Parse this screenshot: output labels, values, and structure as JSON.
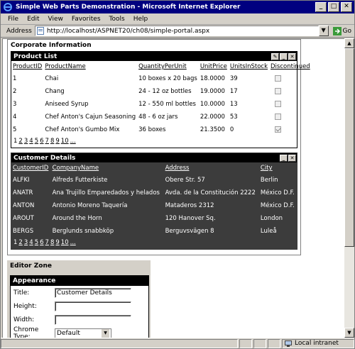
{
  "window": {
    "title": "Simple Web Parts Demonstration - Microsoft Internet Explorer",
    "min": "_",
    "max": "□",
    "close": "✕"
  },
  "menu": [
    "File",
    "Edit",
    "View",
    "Favorites",
    "Tools",
    "Help"
  ],
  "address": {
    "label": "Address",
    "url": "http://localhost/ASPNET20/ch08/simple-portal.aspx",
    "go_label": "Go"
  },
  "zone": {
    "title": "Corporate Information"
  },
  "product_list": {
    "title": "Product List",
    "columns": [
      "ProductID",
      "ProductName",
      "QuantityPerUnit",
      "UnitPrice",
      "UnitsInStock",
      "Discontinued"
    ],
    "rows": [
      {
        "id": "1",
        "name": "Chai",
        "qty": "10 boxes x 20 bags",
        "price": "18.0000",
        "stock": "39",
        "discontinued": false
      },
      {
        "id": "2",
        "name": "Chang",
        "qty": "24 - 12 oz bottles",
        "price": "19.0000",
        "stock": "17",
        "discontinued": false
      },
      {
        "id": "3",
        "name": "Aniseed Syrup",
        "qty": "12 - 550 ml bottles",
        "price": "10.0000",
        "stock": "13",
        "discontinued": false
      },
      {
        "id": "4",
        "name": "Chef Anton's Cajun Seasoning",
        "qty": "48 - 6 oz jars",
        "price": "22.0000",
        "stock": "53",
        "discontinued": false
      },
      {
        "id": "5",
        "name": "Chef Anton's Gumbo Mix",
        "qty": "36 boxes",
        "price": "21.3500",
        "stock": "0",
        "discontinued": true
      }
    ],
    "pager": {
      "current": "1",
      "pages": [
        "2",
        "3",
        "4",
        "5",
        "6",
        "7",
        "8",
        "9",
        "10",
        "..."
      ]
    }
  },
  "customer_details": {
    "title": "Customer Details",
    "columns": [
      "CustomerID",
      "CompanyName",
      "Address",
      "City"
    ],
    "rows": [
      {
        "id": "ALFKI",
        "company": "Alfreds Futterkiste",
        "address": "Obere Str. 57",
        "city": "Berlin"
      },
      {
        "id": "ANATR",
        "company": "Ana Trujillo Emparedados y helados",
        "address": "Avda. de la Constitución 2222",
        "city": "México D.F."
      },
      {
        "id": "ANTON",
        "company": "Antonio Moreno Taquería",
        "address": "Mataderos 2312",
        "city": "México D.F."
      },
      {
        "id": "AROUT",
        "company": "Around the Horn",
        "address": "120 Hanover Sq.",
        "city": "London"
      },
      {
        "id": "BERGS",
        "company": "Berglunds snabbköp",
        "address": "Berguvsvägen 8",
        "city": "Luleå"
      }
    ],
    "pager": {
      "current": "1",
      "pages": [
        "2",
        "3",
        "4",
        "5",
        "6",
        "7",
        "8",
        "9",
        "10",
        "..."
      ]
    }
  },
  "editor_zone": {
    "title": "Editor Zone",
    "appearance_title": "Appearance",
    "fields": {
      "title_label": "Title:",
      "title_value": "Customer Details",
      "height_label": "Height:",
      "width_label": "Width:",
      "chrome_label": "Chrome Type:",
      "chrome_value": "Default"
    }
  },
  "status": {
    "text": "",
    "zone": "Local intranet"
  }
}
